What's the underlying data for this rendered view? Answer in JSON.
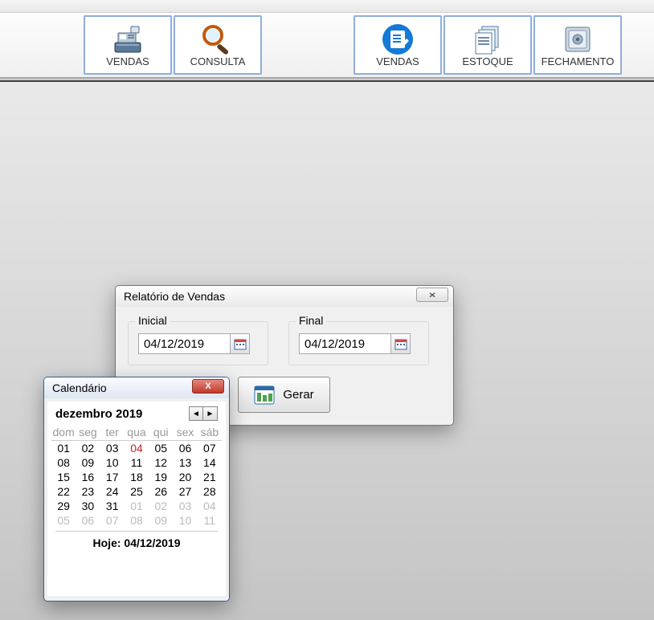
{
  "toolbar": {
    "vendas_cash": "VENDAS",
    "consulta": "CONSULTA",
    "vendas_doc": "VENDAS",
    "estoque": "ESTOQUE",
    "fechamento": "FECHAMENTO"
  },
  "dialog": {
    "title": "Relatório de Vendas",
    "inicial_label": "Inicial",
    "inicial_value": "04/12/2019",
    "final_label": "Final",
    "final_value": "04/12/2019",
    "gerar_label": "Gerar",
    "close_glyph": "✕"
  },
  "calendar": {
    "title": "Calendário",
    "close_glyph": "X",
    "month_label": "dezembro 2019",
    "prev": "◄",
    "next": "►",
    "weekdays": [
      "dom",
      "seg",
      "ter",
      "qua",
      "qui",
      "sex",
      "sáb"
    ],
    "rows": [
      [
        {
          "d": "01"
        },
        {
          "d": "02"
        },
        {
          "d": "03"
        },
        {
          "d": "04",
          "today": true
        },
        {
          "d": "05"
        },
        {
          "d": "06"
        },
        {
          "d": "07"
        }
      ],
      [
        {
          "d": "08"
        },
        {
          "d": "09"
        },
        {
          "d": "10"
        },
        {
          "d": "11"
        },
        {
          "d": "12"
        },
        {
          "d": "13"
        },
        {
          "d": "14"
        }
      ],
      [
        {
          "d": "15"
        },
        {
          "d": "16"
        },
        {
          "d": "17"
        },
        {
          "d": "18"
        },
        {
          "d": "19"
        },
        {
          "d": "20"
        },
        {
          "d": "21"
        }
      ],
      [
        {
          "d": "22"
        },
        {
          "d": "23"
        },
        {
          "d": "24"
        },
        {
          "d": "25"
        },
        {
          "d": "26"
        },
        {
          "d": "27"
        },
        {
          "d": "28"
        }
      ],
      [
        {
          "d": "29"
        },
        {
          "d": "30"
        },
        {
          "d": "31"
        },
        {
          "d": "01",
          "other": true
        },
        {
          "d": "02",
          "other": true
        },
        {
          "d": "03",
          "other": true
        },
        {
          "d": "04",
          "other": true
        }
      ],
      [
        {
          "d": "05",
          "other": true
        },
        {
          "d": "06",
          "other": true
        },
        {
          "d": "07",
          "other": true
        },
        {
          "d": "08",
          "other": true
        },
        {
          "d": "09",
          "other": true
        },
        {
          "d": "10",
          "other": true
        },
        {
          "d": "11",
          "other": true
        }
      ]
    ],
    "today_label": "Hoje: 04/12/2019"
  }
}
